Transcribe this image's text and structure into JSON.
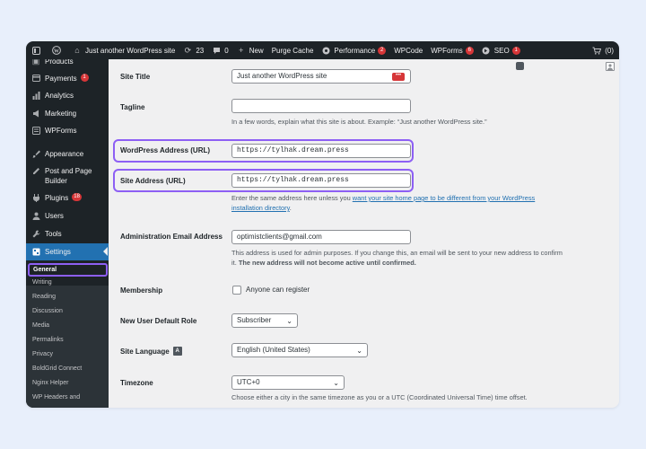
{
  "admin_bar": {
    "site_name": "Just another WordPress site",
    "updates_count": "23",
    "comments_count": "0",
    "new_label": "New",
    "purge_cache_label": "Purge Cache",
    "performance_label": "Performance",
    "performance_badge": "2",
    "wpcode_label": "WPCode",
    "wpforms_label": "WPForms",
    "wpforms_badge": "6",
    "seo_label": "SEO",
    "seo_badge": "1",
    "cart_label": "(0)"
  },
  "sidebar": {
    "products": "Products",
    "payments": "Payments",
    "payments_badge": "1",
    "analytics": "Analytics",
    "marketing": "Marketing",
    "wpforms": "WPForms",
    "appearance": "Appearance",
    "post_page_builder_1": "Post and Page",
    "post_page_builder_2": "Builder",
    "plugins": "Plugins",
    "plugins_badge": "18",
    "users": "Users",
    "tools": "Tools",
    "settings": "Settings",
    "submenu": {
      "general": "General",
      "writing": "Writing",
      "reading": "Reading",
      "discussion": "Discussion",
      "media": "Media",
      "permalinks": "Permalinks",
      "privacy": "Privacy",
      "boldgrid_connect": "BoldGrid Connect",
      "nginx_helper": "Nginx Helper",
      "wp_headers": "WP Headers and"
    }
  },
  "form": {
    "site_title_label": "Site Title",
    "site_title_value": "Just another WordPress site",
    "tagline_label": "Tagline",
    "tagline_value": "",
    "tagline_desc": "In a few words, explain what this site is about. Example: “Just another WordPress site.”",
    "wp_address_label": "WordPress Address (URL)",
    "wp_address_value": "https://tylhak.dream.press",
    "site_address_label": "Site Address (URL)",
    "site_address_value": "https://tylhak.dream.press",
    "site_address_desc_1": "Enter the same address here unless you",
    "site_address_link_1": "want your site home page to be different from your WordPress",
    "site_address_link_2": "installation directory",
    "site_address_desc_end": ".",
    "admin_email_label": "Administration Email Address",
    "admin_email_value": "optimistclients@gmail.com",
    "admin_email_desc_1": "This address is used for admin purposes. If you change this, an email will be sent to your new address to confirm",
    "admin_email_desc_2a": "it.",
    "admin_email_desc_2b": "The new address will not become active until confirmed.",
    "membership_label": "Membership",
    "membership_checkbox_label": "Anyone can register",
    "default_role_label": "New User Default Role",
    "default_role_value": "Subscriber",
    "site_language_label": "Site Language",
    "site_language_value": "English (United States)",
    "timezone_label": "Timezone",
    "timezone_value": "UTC+0",
    "timezone_desc": "Choose either a city in the same timezone as you or a UTC (Coordinated Universal Time) time offset."
  },
  "colors": {
    "admin_bar_bg": "#1d2327",
    "active_menu": "#2271b1",
    "highlight": "#8d5ff4",
    "badge": "#d63638"
  }
}
